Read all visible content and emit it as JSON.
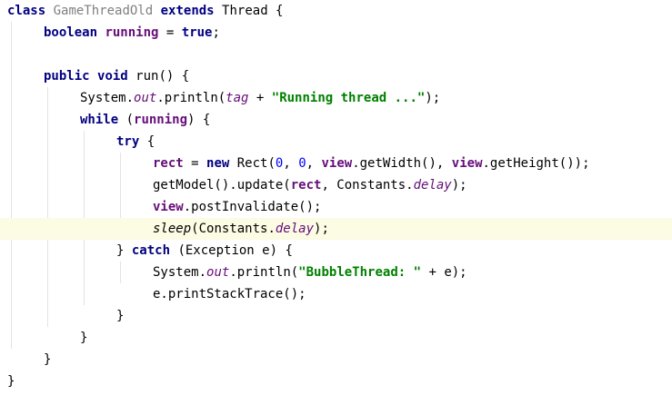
{
  "editor": {
    "highlighted_line_index": 10,
    "colors": {
      "keyword": "#000080",
      "field": "#660e7a",
      "string": "#008000",
      "number": "#0000ff",
      "unused": "#808080",
      "current_line_background": "#fcfbe4",
      "indent_guide": "#e2e2e2"
    },
    "lines": [
      {
        "indent": 0,
        "tokens": [
          [
            "kw",
            "class"
          ],
          [
            "plain",
            " "
          ],
          [
            "unused",
            "GameThreadOld"
          ],
          [
            "plain",
            " "
          ],
          [
            "kw",
            "extends"
          ],
          [
            "plain",
            " Thread {"
          ]
        ]
      },
      {
        "indent": 1,
        "tokens": [
          [
            "kw",
            "boolean"
          ],
          [
            "plain",
            " "
          ],
          [
            "field",
            "running"
          ],
          [
            "plain",
            " = "
          ],
          [
            "kw",
            "true"
          ],
          [
            "plain",
            ";"
          ]
        ]
      },
      {
        "indent": 0,
        "tokens": []
      },
      {
        "indent": 1,
        "tokens": [
          [
            "kw",
            "public"
          ],
          [
            "plain",
            " "
          ],
          [
            "kw",
            "void"
          ],
          [
            "plain",
            " run() {"
          ]
        ]
      },
      {
        "indent": 2,
        "tokens": [
          [
            "plain",
            "System."
          ],
          [
            "sfield",
            "out"
          ],
          [
            "plain",
            ".println("
          ],
          [
            "sfield",
            "tag"
          ],
          [
            "plain",
            " + "
          ],
          [
            "str",
            "\"Running thread ...\""
          ],
          [
            "plain",
            ");"
          ]
        ]
      },
      {
        "indent": 2,
        "tokens": [
          [
            "kw",
            "while"
          ],
          [
            "plain",
            " ("
          ],
          [
            "field",
            "running"
          ],
          [
            "plain",
            ") {"
          ]
        ]
      },
      {
        "indent": 3,
        "tokens": [
          [
            "kw",
            "try"
          ],
          [
            "plain",
            " {"
          ]
        ]
      },
      {
        "indent": 4,
        "tokens": [
          [
            "field",
            "rect"
          ],
          [
            "plain",
            " = "
          ],
          [
            "kw",
            "new"
          ],
          [
            "plain",
            " Rect("
          ],
          [
            "num",
            "0"
          ],
          [
            "plain",
            ", "
          ],
          [
            "num",
            "0"
          ],
          [
            "plain",
            ", "
          ],
          [
            "field",
            "view"
          ],
          [
            "plain",
            ".getWidth(), "
          ],
          [
            "field",
            "view"
          ],
          [
            "plain",
            ".getHeight());"
          ]
        ]
      },
      {
        "indent": 4,
        "tokens": [
          [
            "plain",
            "getModel().update("
          ],
          [
            "field",
            "rect"
          ],
          [
            "plain",
            ", Constants."
          ],
          [
            "sfield",
            "delay"
          ],
          [
            "plain",
            ");"
          ]
        ]
      },
      {
        "indent": 4,
        "tokens": [
          [
            "field",
            "view"
          ],
          [
            "plain",
            ".postInvalidate();"
          ]
        ]
      },
      {
        "indent": 4,
        "tokens": [
          [
            "smethod",
            "sleep"
          ],
          [
            "plain",
            "(Constants."
          ],
          [
            "sfield",
            "delay"
          ],
          [
            "plain",
            ");"
          ]
        ]
      },
      {
        "indent": 3,
        "tokens": [
          [
            "plain",
            "} "
          ],
          [
            "kw",
            "catch"
          ],
          [
            "plain",
            " (Exception e) {"
          ]
        ]
      },
      {
        "indent": 4,
        "tokens": [
          [
            "plain",
            "System."
          ],
          [
            "sfield",
            "out"
          ],
          [
            "plain",
            ".println("
          ],
          [
            "str",
            "\"BubbleThread: \""
          ],
          [
            "plain",
            " + e);"
          ]
        ]
      },
      {
        "indent": 4,
        "tokens": [
          [
            "plain",
            "e.printStackTrace();"
          ]
        ]
      },
      {
        "indent": 3,
        "tokens": [
          [
            "plain",
            "}"
          ]
        ]
      },
      {
        "indent": 2,
        "tokens": [
          [
            "plain",
            "}"
          ]
        ]
      },
      {
        "indent": 1,
        "tokens": [
          [
            "plain",
            "}"
          ]
        ]
      },
      {
        "indent": 0,
        "tokens": [
          [
            "plain",
            "}"
          ]
        ]
      }
    ]
  }
}
